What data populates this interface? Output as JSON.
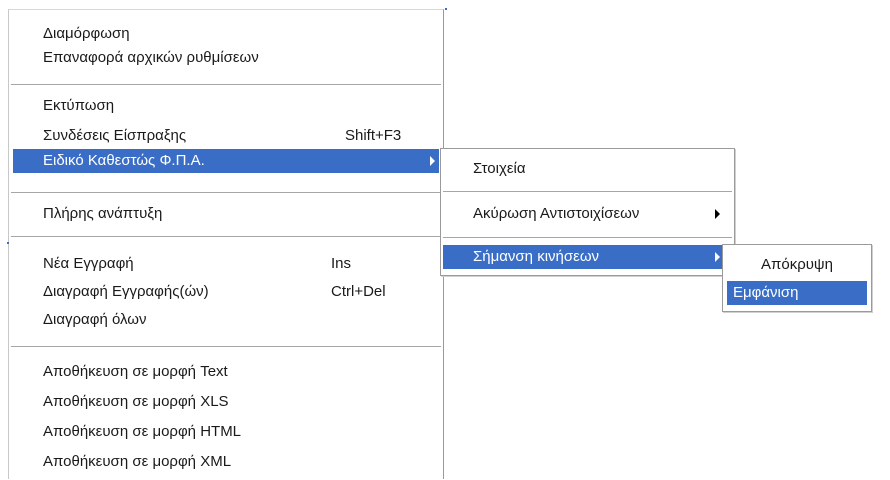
{
  "main_menu": {
    "items": [
      {
        "label": "Διαμόρφωση"
      },
      {
        "label": "Επαναφορά αρχικών ρυθμίσεων"
      },
      {
        "label": "Εκτύπωση"
      },
      {
        "label": "Συνδέσεις Είσπραξης",
        "shortcut": "Shift+F3"
      },
      {
        "label": "Ειδικό Καθεστώς Φ.Π.Α.",
        "has_submenu": true,
        "selected": true
      },
      {
        "label": "Πλήρης ανάπτυξη"
      },
      {
        "label": "Νέα Εγγραφή",
        "shortcut": "Ins"
      },
      {
        "label": "Διαγραφή Εγγραφής(ών)",
        "shortcut": "Ctrl+Del"
      },
      {
        "label": "Διαγραφή όλων"
      },
      {
        "label": "Αποθήκευση σε μορφή Text"
      },
      {
        "label": "Αποθήκευση σε μορφή XLS"
      },
      {
        "label": "Αποθήκευση σε μορφή HTML"
      },
      {
        "label": "Αποθήκευση σε μορφή XML"
      }
    ]
  },
  "submenu_vat": {
    "items": [
      {
        "label": "Στοιχεία"
      },
      {
        "label": "Ακύρωση Αντιστοιχίσεων",
        "has_submenu": true
      },
      {
        "label": "Σήμανση κινήσεων",
        "has_submenu": true,
        "selected": true
      }
    ]
  },
  "submenu_marking": {
    "items": [
      {
        "label": "Απόκρυψη"
      },
      {
        "label": "Εμφάνιση",
        "selected": true
      }
    ]
  },
  "colors": {
    "selection": "#3a6ec6",
    "selection_text": "#ffffff",
    "text": "#1a1a1a",
    "separator": "#a6a6a6"
  }
}
